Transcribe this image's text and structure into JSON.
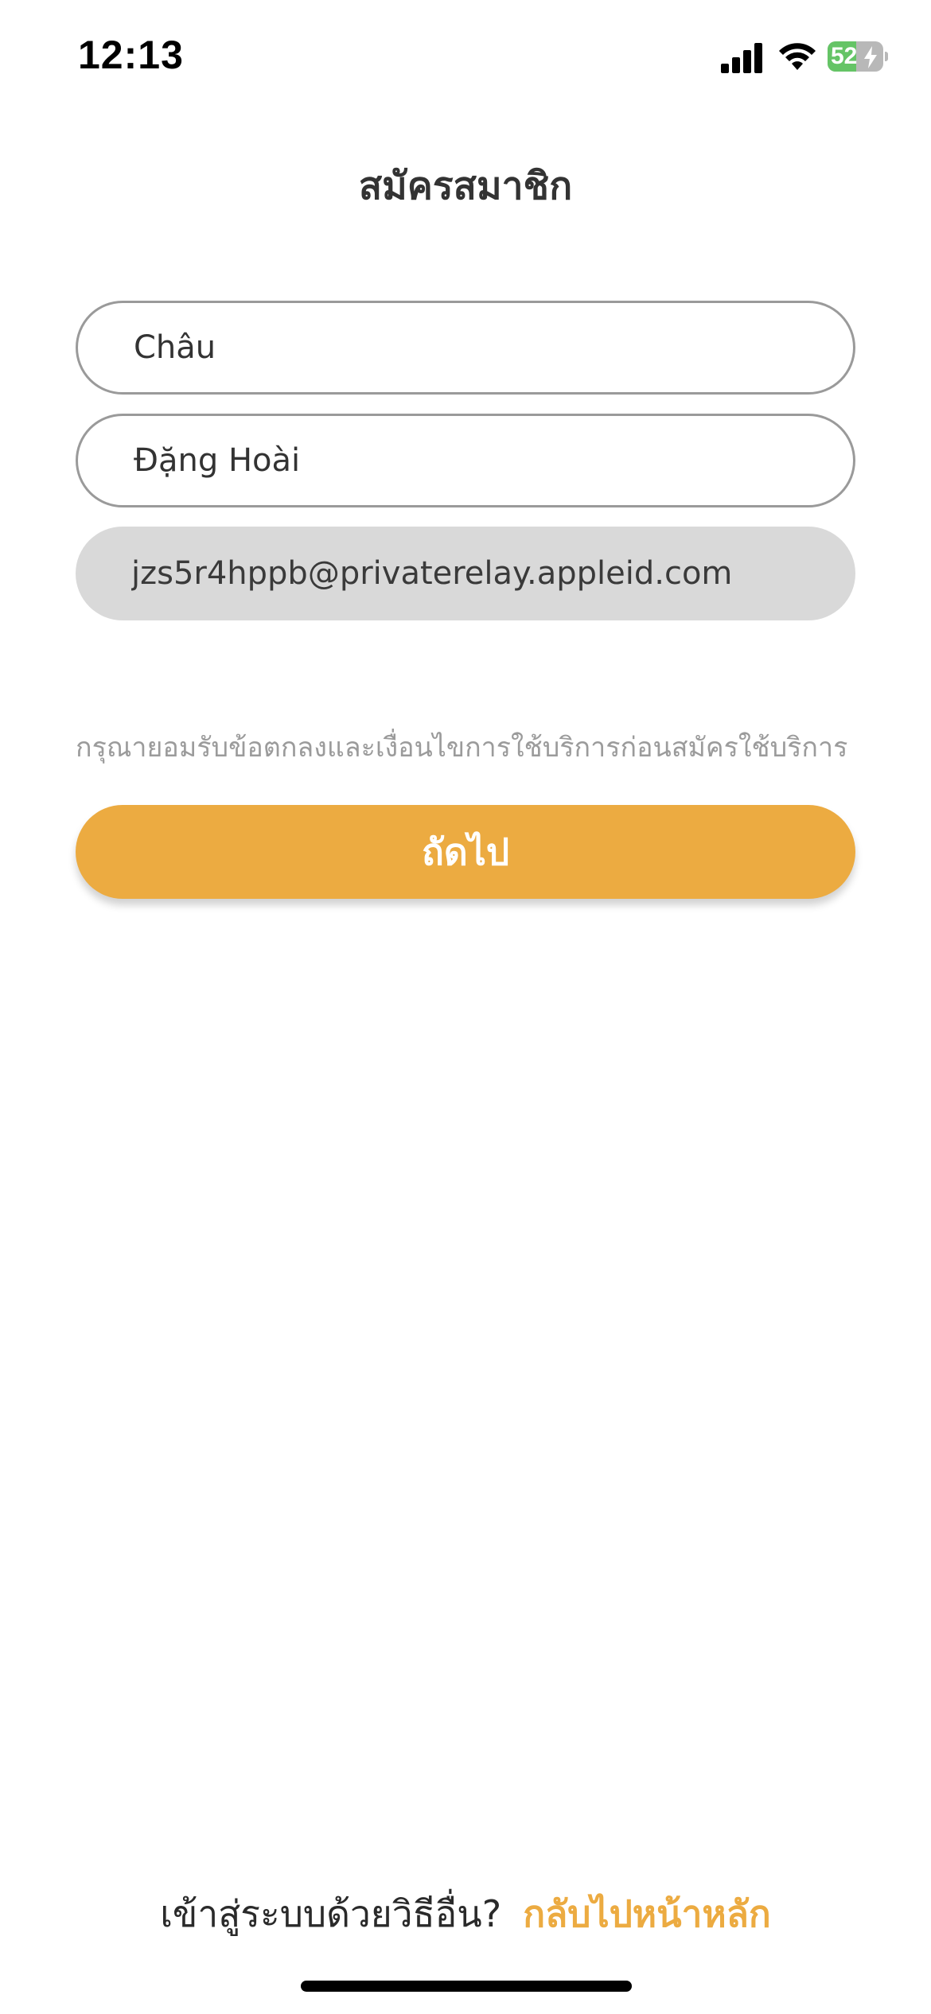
{
  "status_bar": {
    "time": "12:13",
    "battery_level": "52",
    "icons": [
      "cellular-signal-icon",
      "wifi-icon",
      "battery-charging-icon"
    ],
    "battery_fill_percent": 52
  },
  "page": {
    "title": "สมัครสมาชิก"
  },
  "form": {
    "first_name_value": "Châu",
    "last_name_value": "Đặng Hoài",
    "email_value": "jzs5r4hppb@privaterelay.appleid.com",
    "email_disabled": true,
    "terms_note": "กรุณายอมรับข้อตกลงและเงื่อนไขการใช้บริการก่อนสมัครใช้บริการ",
    "next_label": "ถัดไป"
  },
  "footer": {
    "question": "เข้าสู่ระบบด้วยวิธีอื่น?",
    "back_link": "กลับไปหน้าหลัก"
  },
  "colors": {
    "accent": "#ecab41",
    "field_border": "#9a9a9a",
    "disabled_field_bg": "#d9d9d9",
    "battery_green": "#65c466"
  }
}
